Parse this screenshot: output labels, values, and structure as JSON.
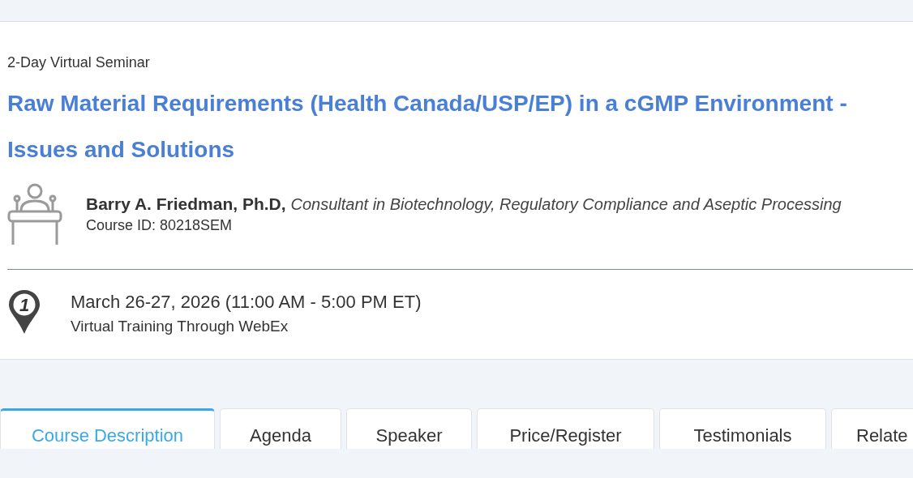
{
  "course": {
    "format": "2-Day Virtual Seminar",
    "title_lines": [
      "Raw Material Requirements (Health Canada/USP/EP) in a cGMP Environment -",
      "Issues and Solutions"
    ],
    "speaker": {
      "name": "Barry A. Friedman, Ph.D,",
      "role": "Consultant in Biotechnology, Regulatory Compliance and Aseptic Processing"
    },
    "course_id": "Course ID: 80218SEM",
    "session": {
      "pin_number": "1",
      "date": "March 26-27, 2026 (11:00 AM - 5:00 PM ET)",
      "location": "Virtual Training Through WebEx"
    }
  },
  "tabs": [
    {
      "label": "Course Description",
      "selected": true
    },
    {
      "label": "Agenda",
      "selected": false
    },
    {
      "label": "Speaker",
      "selected": false
    },
    {
      "label": "Price/Register",
      "selected": false
    },
    {
      "label": "Testimonials",
      "selected": false
    },
    {
      "label": "Relate",
      "selected": false
    }
  ]
}
